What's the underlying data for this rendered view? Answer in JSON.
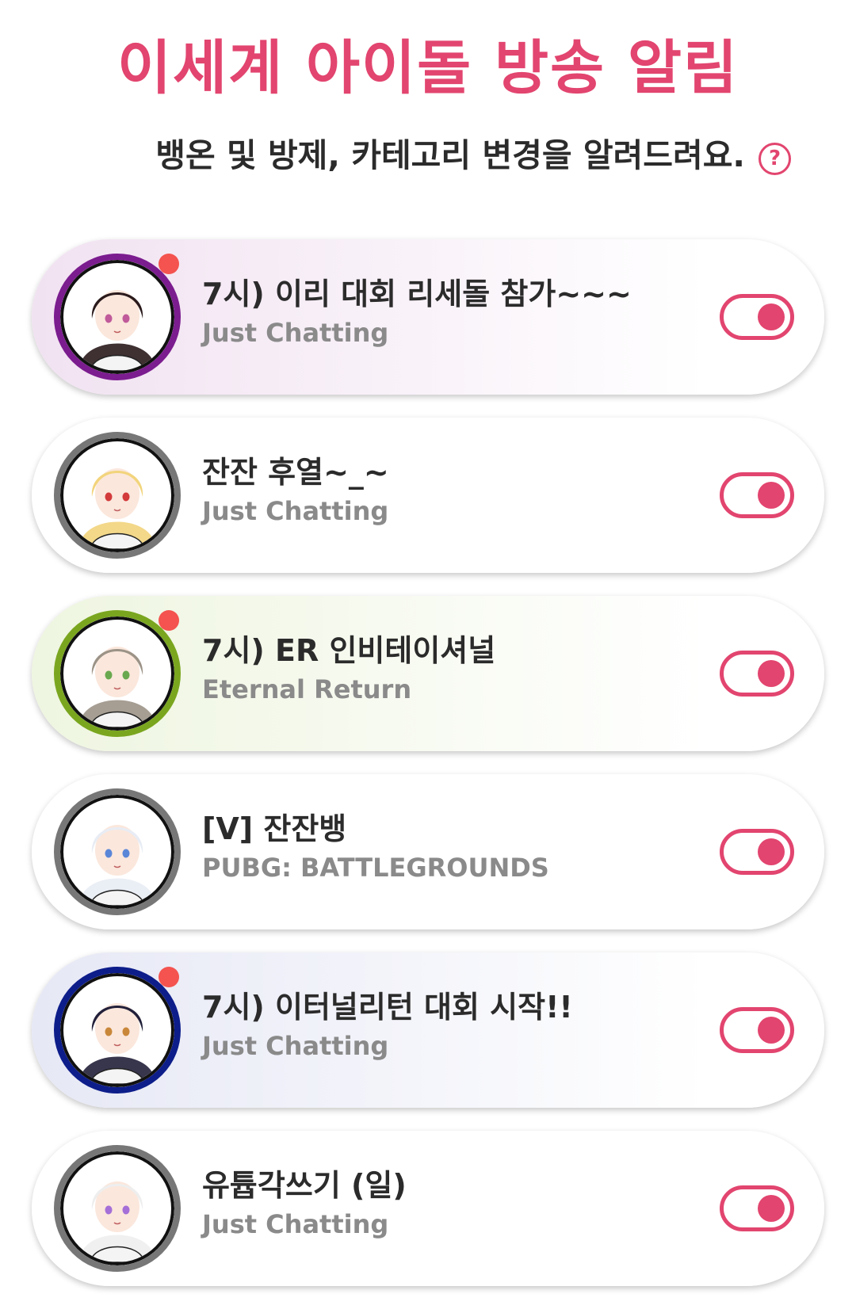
{
  "header": {
    "title": "이세계 아이돌 방송 알림",
    "subtitle": "뱅온 및 방제, 카테고리 변경을 알려드려요.",
    "help_icon": "question-circle-icon",
    "help_label": "?"
  },
  "colors": {
    "accent": "#e2456f",
    "live_dot": "#f4534f"
  },
  "streamers": [
    {
      "title": "7시) 이리 대회 리세돌 참가~~~",
      "category": "Just Chatting",
      "live": true,
      "ring_color": "#7b1c8f",
      "card_tint": "#f1e2f1",
      "hair_color": "#2a1a1c",
      "eye_color": "#c05a9a",
      "notify_on": true
    },
    {
      "title": "잔잔 후열~_~",
      "category": "Just Chatting",
      "live": false,
      "ring_color": "#777777",
      "card_tint": "#ffffff",
      "hair_color": "#f2d47c",
      "eye_color": "#d33a3a",
      "notify_on": true
    },
    {
      "title": "7시) ER 인비테이셔널",
      "category": "Eternal Return",
      "live": true,
      "ring_color": "#7aa61f",
      "card_tint": "#eef5e0",
      "hair_color": "#9c9387",
      "eye_color": "#6aa84f",
      "notify_on": true
    },
    {
      "title": "[V] 잔잔뱅",
      "category": "PUBG: BATTLEGROUNDS",
      "live": false,
      "ring_color": "#777777",
      "card_tint": "#ffffff",
      "hair_color": "#e8ecf4",
      "eye_color": "#5a86d8",
      "notify_on": true
    },
    {
      "title": "7시) 이터널리턴 대회 시작!!",
      "category": "Just Chatting",
      "live": true,
      "ring_color": "#0d1d8a",
      "card_tint": "#e6e8f5",
      "hair_color": "#22203a",
      "eye_color": "#c9873a",
      "notify_on": true
    },
    {
      "title": "유튭각쓰기 (일)",
      "category": "Just Chatting",
      "live": false,
      "ring_color": "#777777",
      "card_tint": "#ffffff",
      "hair_color": "#eeeeee",
      "eye_color": "#a56fd8",
      "notify_on": true
    }
  ]
}
